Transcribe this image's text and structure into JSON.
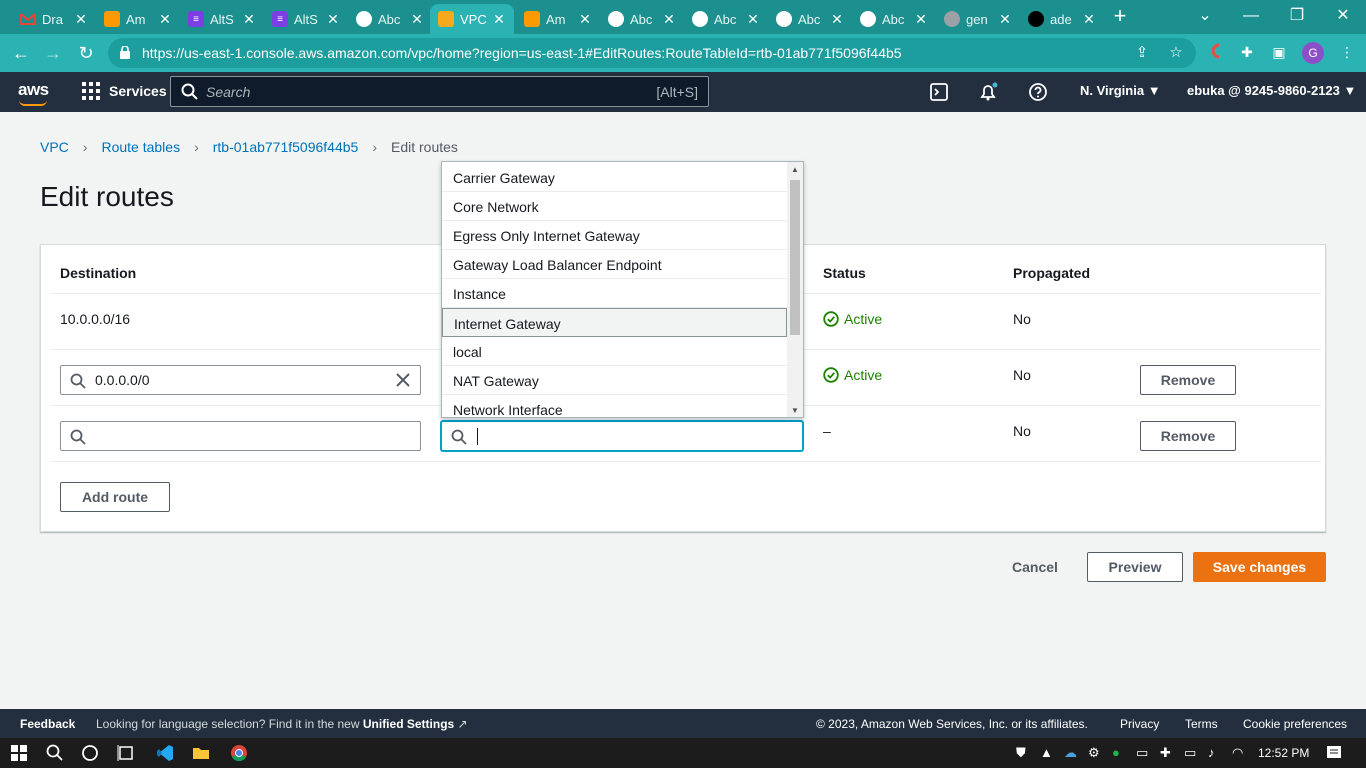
{
  "browser": {
    "tabs": [
      {
        "label": "Dra",
        "icon": "gmail-icon",
        "color": "#ea4335"
      },
      {
        "label": "Am",
        "icon": "aws-icon",
        "color": "#ff9900"
      },
      {
        "label": "AltS",
        "icon": "list-icon",
        "color": "#7b3fe4"
      },
      {
        "label": "AltS",
        "icon": "list-icon",
        "color": "#7b3fe4"
      },
      {
        "label": "Abc",
        "icon": "chrome-icon",
        "color": "#ffffff"
      },
      {
        "label": "VPC",
        "icon": "vpc-icon",
        "color": "#f7a81b"
      },
      {
        "label": "Am",
        "icon": "aws-icon",
        "color": "#ff9900"
      },
      {
        "label": "Abc",
        "icon": "chrome-icon",
        "color": "#ffffff"
      },
      {
        "label": "Abc",
        "icon": "chrome-icon",
        "color": "#ffffff"
      },
      {
        "label": "Abc",
        "icon": "chrome-icon",
        "color": "#ffffff"
      },
      {
        "label": "Abc",
        "icon": "chrome-icon",
        "color": "#ffffff"
      },
      {
        "label": "gen",
        "icon": "globe-icon",
        "color": "#9aa0a6"
      },
      {
        "label": "ade",
        "icon": "github-icon",
        "color": "#000000"
      }
    ],
    "active_tab": 5,
    "url": "https://us-east-1.console.aws.amazon.com/vpc/home?region=us-east-1#EditRoutes:RouteTableId=rtb-01ab771f5096f44b5",
    "profile_initial": "G"
  },
  "awsnav": {
    "logo": "aws",
    "services": "Services",
    "search_placeholder": "Search",
    "search_shortcut": "[Alt+S]",
    "region": "N. Virginia",
    "account": "ebuka @ 9245-9860-2123"
  },
  "breadcrumb": {
    "vpc": "VPC",
    "route_tables": "Route tables",
    "route_table_id": "rtb-01ab771f5096f44b5",
    "current": "Edit routes"
  },
  "page_title": "Edit routes",
  "table": {
    "headers": {
      "destination": "Destination",
      "status": "Status",
      "propagated": "Propagated"
    },
    "rows": [
      {
        "destination": "10.0.0.0/16",
        "status": "Active",
        "propagated": "No"
      },
      {
        "destination": "0.0.0.0/0",
        "status": "Active",
        "propagated": "No",
        "remove": "Remove"
      },
      {
        "destination": "",
        "status": "–",
        "propagated": "No",
        "remove": "Remove"
      }
    ]
  },
  "dropdown": {
    "options": [
      "Carrier Gateway",
      "Core Network",
      "Egress Only Internet Gateway",
      "Gateway Load Balancer Endpoint",
      "Instance",
      "Internet Gateway",
      "local",
      "NAT Gateway",
      "Network Interface"
    ],
    "highlighted": "Internet Gateway"
  },
  "actions": {
    "add_route": "Add route",
    "cancel": "Cancel",
    "preview": "Preview",
    "save": "Save changes"
  },
  "colors": {
    "primary": "#ec7211",
    "link": "#0073bb",
    "success": "#1d8102",
    "nav": "#232f3e"
  },
  "footer": {
    "feedback": "Feedback",
    "lang_text": "Looking for language selection? Find it in the new",
    "unified_settings": "Unified Settings",
    "copyright": "© 2023, Amazon Web Services, Inc. or its affiliates.",
    "privacy": "Privacy",
    "terms": "Terms",
    "cookies": "Cookie preferences"
  },
  "taskbar": {
    "time": "12:52 PM"
  }
}
